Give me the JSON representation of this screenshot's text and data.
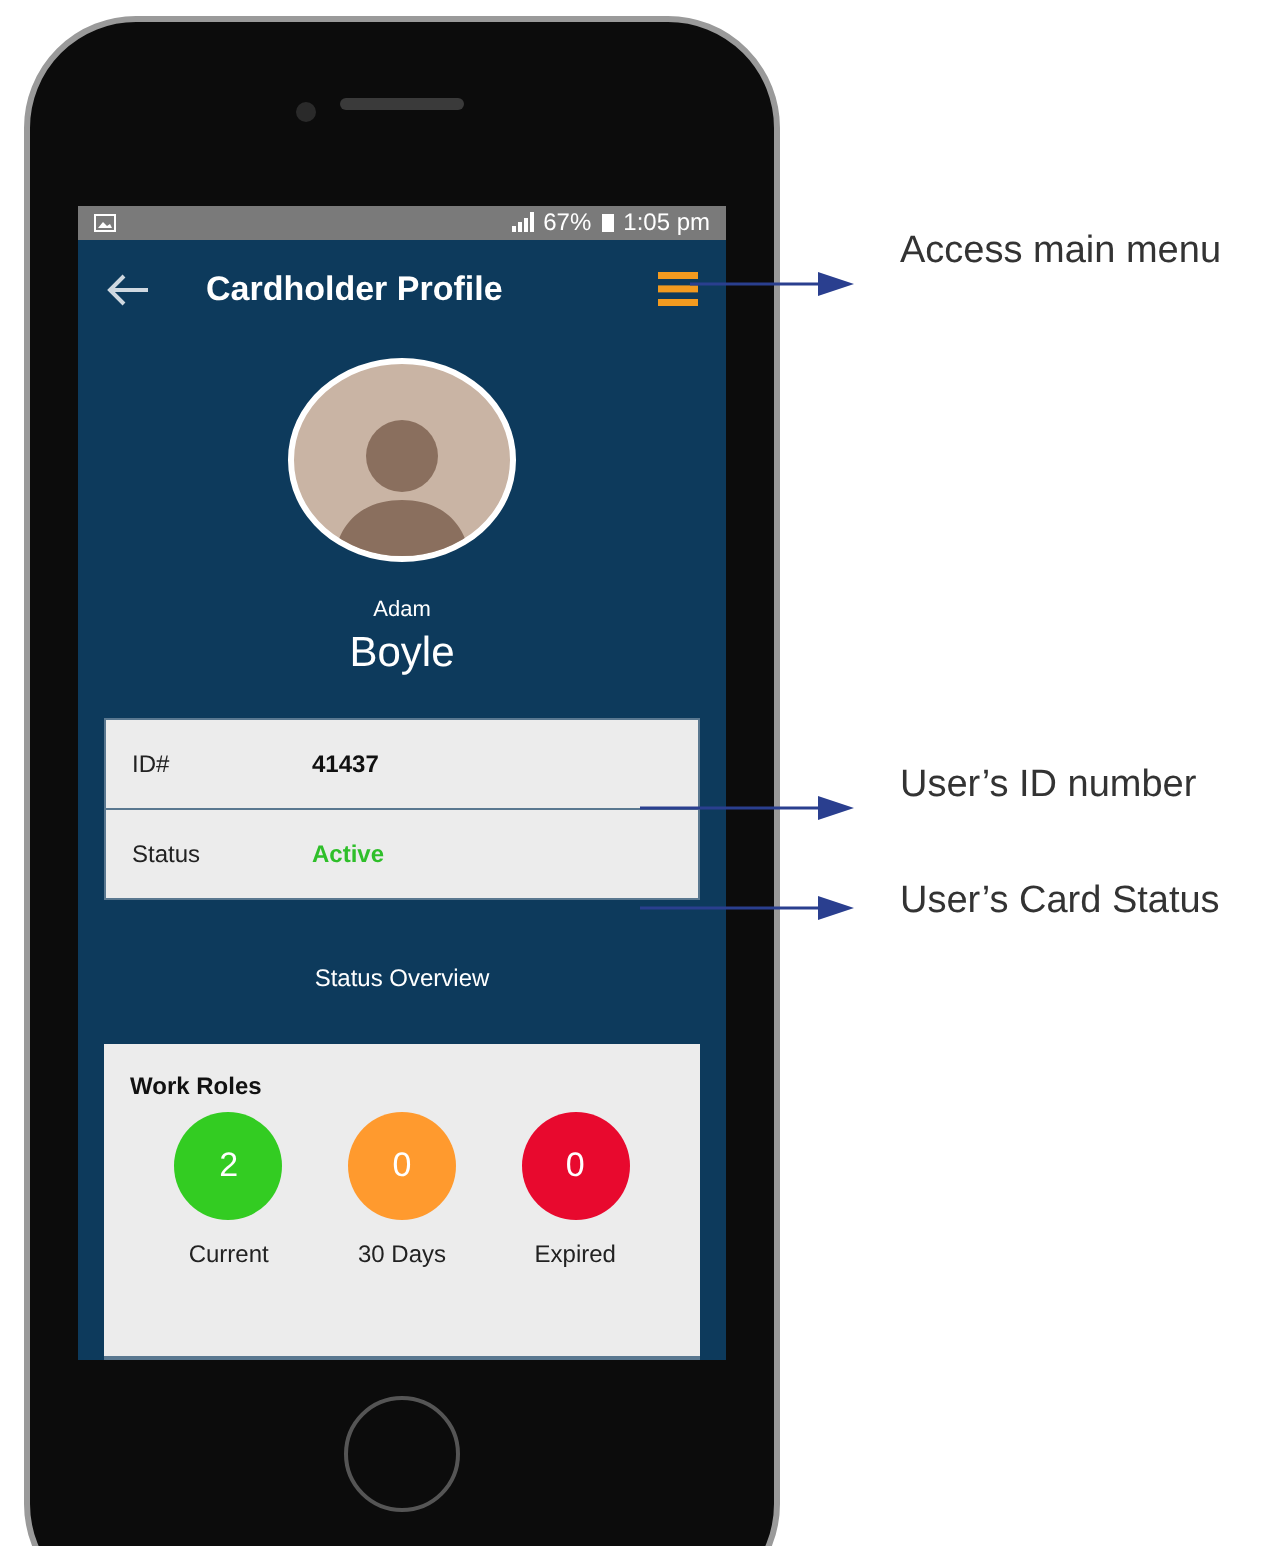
{
  "status_bar": {
    "battery": "67%",
    "time": "1:05 pm"
  },
  "app_bar": {
    "title": "Cardholder Profile"
  },
  "profile": {
    "first_name": "Adam",
    "last_name": "Boyle"
  },
  "details": [
    {
      "label": "ID#",
      "value": "41437",
      "kind": "plain"
    },
    {
      "label": "Status",
      "value": "Active",
      "kind": "status"
    }
  ],
  "section_title": "Status Overview",
  "work_roles": {
    "title": "Work Roles",
    "counts": [
      {
        "value": "2",
        "label": "Current",
        "color": "#33cc22"
      },
      {
        "value": "0",
        "label": "30 Days",
        "color": "#ff9a2e"
      },
      {
        "value": "0",
        "label": "Expired",
        "color": "#e8092e"
      }
    ]
  },
  "annotations": [
    {
      "text": "Access main menu"
    },
    {
      "text": "User’s ID number"
    },
    {
      "text": "User’s Card Status"
    }
  ]
}
